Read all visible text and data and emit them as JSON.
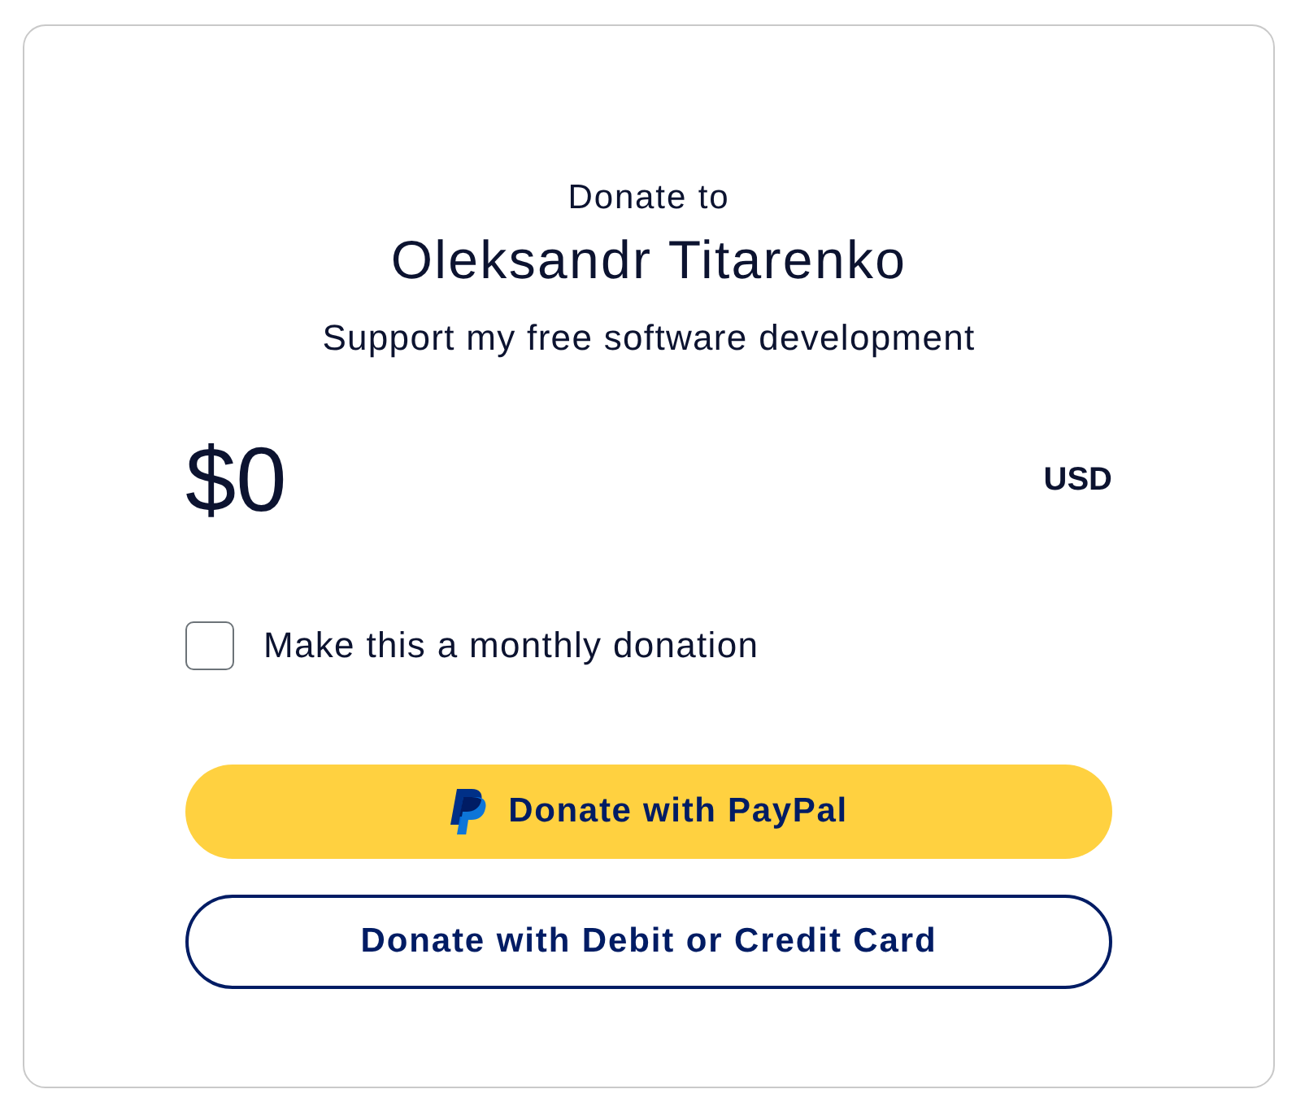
{
  "header": {
    "intro": "Donate to",
    "recipient": "Oleksandr Titarenko",
    "purpose": "Support my free software development"
  },
  "amount": {
    "value": "$0",
    "currency": "USD"
  },
  "monthly": {
    "label": "Make this a monthly donation",
    "checked": false
  },
  "buttons": [
    {
      "kind": "paypal",
      "label": "Donate with PayPal"
    },
    {
      "kind": "card",
      "label": "Donate with Debit or Credit Card"
    }
  ]
}
